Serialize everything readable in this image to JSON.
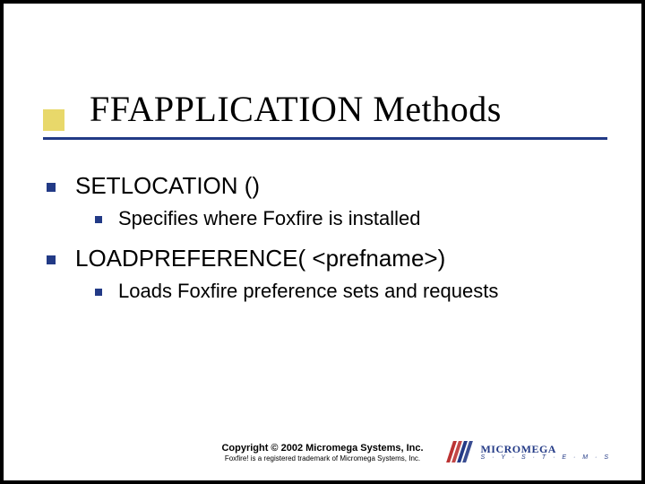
{
  "title": "FFAPPLICATION Methods",
  "items": [
    {
      "label": "SETLOCATION ()",
      "sub": [
        {
          "label": "Specifies where Foxfire is installed"
        }
      ]
    },
    {
      "label": "LOADPREFERENCE( <prefname>)",
      "sub": [
        {
          "label": "Loads Foxfire preference sets and requests"
        }
      ]
    }
  ],
  "footer": {
    "copyright": "Copyright © 2002 Micromega Systems, Inc.",
    "trademark": "Foxfire! is a registered trademark of Micromega Systems, Inc."
  },
  "logo": {
    "name": "MICROMEGA",
    "subtitle": "S · Y · S · T · E · M · S"
  }
}
